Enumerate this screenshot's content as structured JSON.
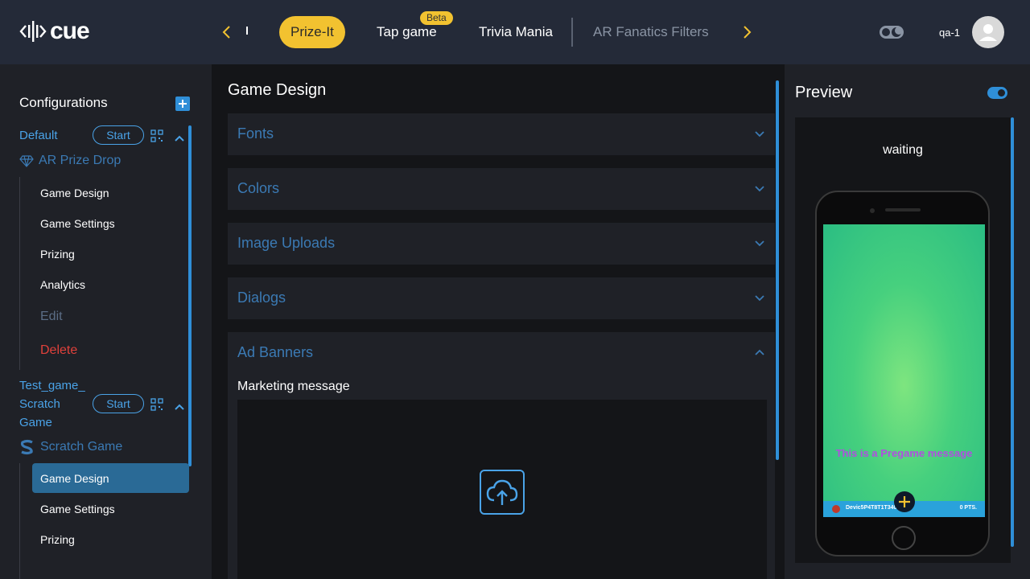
{
  "header": {
    "brand": "cue",
    "tabs": [
      {
        "label": "Prize-It",
        "active": true
      },
      {
        "label": "Tap game",
        "badge": "Beta"
      },
      {
        "label": "Trivia Mania"
      },
      {
        "label": "AR Fanatics Filters"
      }
    ],
    "user": "qa-1"
  },
  "sidebar": {
    "title": "Configurations",
    "configs": [
      {
        "name": "Default",
        "start_label": "Start",
        "game_type": "AR Prize Drop",
        "items": [
          "Game Design",
          "Game Settings",
          "Prizing",
          "Analytics"
        ],
        "edit_label": "Edit",
        "delete_label": "Delete"
      },
      {
        "name_lines": [
          "Test_game_",
          "Scratch",
          "Game"
        ],
        "start_label": "Start",
        "game_type": "Scratch Game",
        "items": [
          "Game Design",
          "Game Settings",
          "Prizing"
        ],
        "selected": "Game Design"
      }
    ]
  },
  "main": {
    "title": "Game Design",
    "sections": [
      "Fonts",
      "Colors",
      "Image Uploads",
      "Dialogs",
      "Ad Banners"
    ],
    "ad_banners": {
      "marketing_label": "Marketing message"
    }
  },
  "preview": {
    "title": "Preview",
    "status": "waiting",
    "pregame_message": "This is a Pregame message",
    "device_id": "Devic5P4T8T1T3405",
    "points": "0 PTS."
  },
  "colors": {
    "accent": "#2f8fd8",
    "brand_yellow": "#f2c230",
    "danger": "#e0413b",
    "header_bg": "#242a38"
  }
}
